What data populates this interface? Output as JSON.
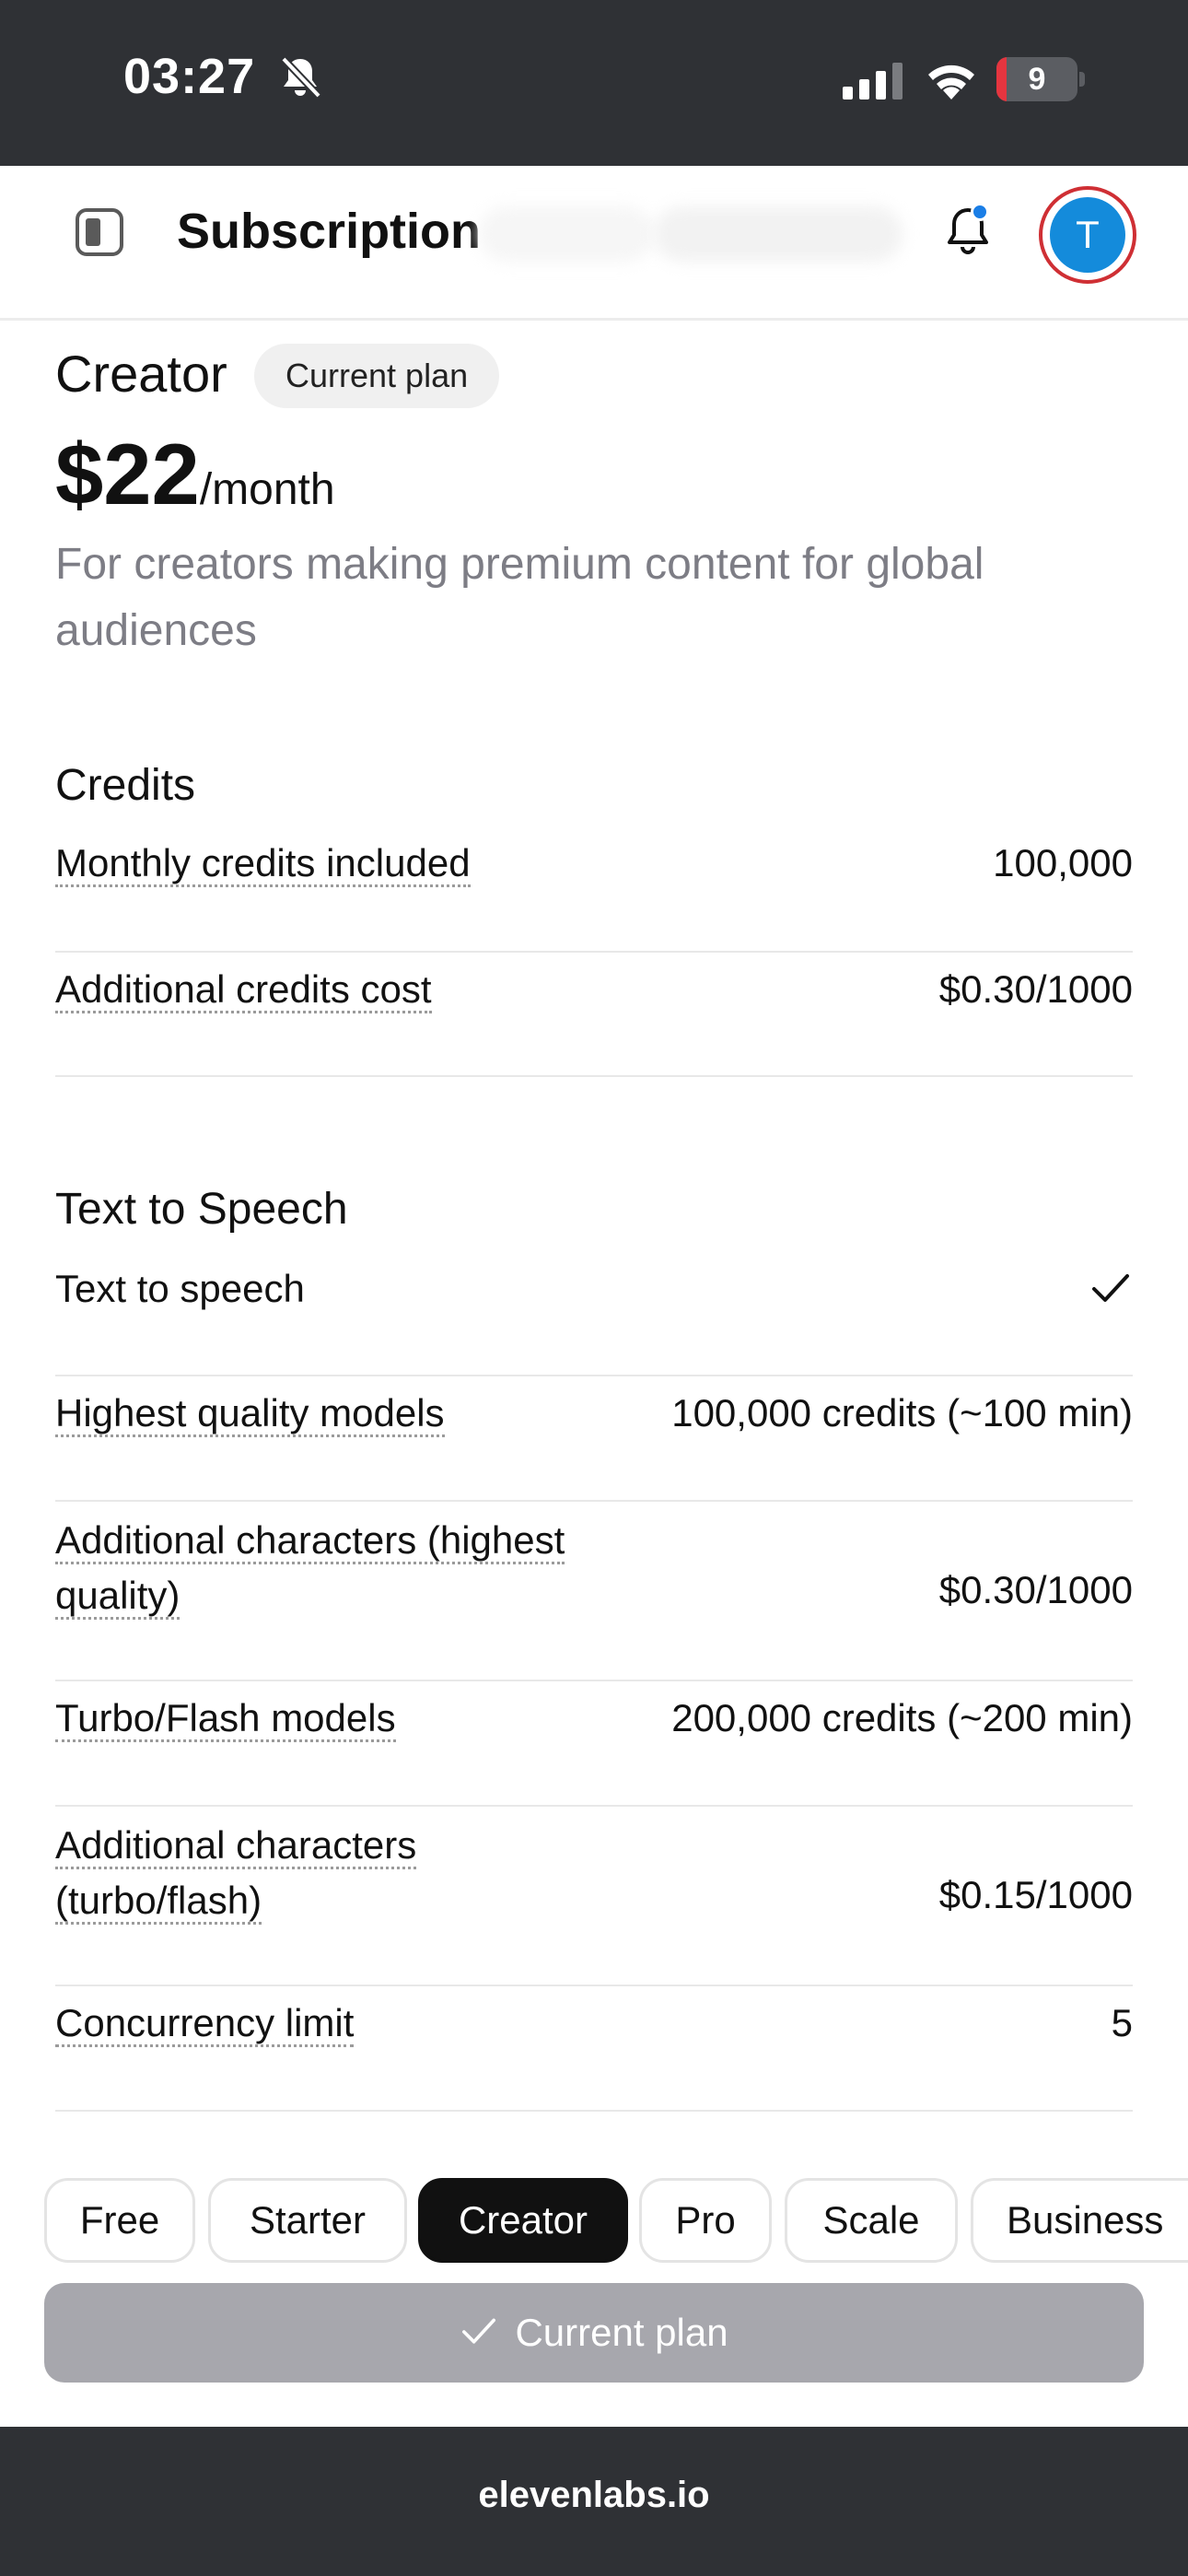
{
  "status_bar": {
    "time": "03:27",
    "battery": "9",
    "battery_level": 0.09
  },
  "header": {
    "title": "Subscription",
    "avatar_initial": "T",
    "accent_color": "#148bdb"
  },
  "plan": {
    "name": "Creator",
    "badge": "Current plan",
    "price": "$22",
    "period": "/month",
    "description": "For creators making premium content for global audiences"
  },
  "sections": {
    "credits": {
      "title": "Credits",
      "rows": [
        {
          "label": "Monthly credits included",
          "value": "100,000"
        },
        {
          "label": "Additional credits cost",
          "value": "$0.30/1000"
        }
      ]
    },
    "tts": {
      "title": "Text to Speech",
      "rows": [
        {
          "label": "Text to speech",
          "value": "check"
        },
        {
          "label": "Highest quality models",
          "value": "100,000 credits (~100 min)"
        },
        {
          "label": "Additional characters (highest quality)",
          "label_line1": "Additional characters (highest",
          "label_line2": "quality)",
          "value": "$0.30/1000"
        },
        {
          "label": "Turbo/Flash models",
          "value": "200,000 credits (~200 min)"
        },
        {
          "label": "Additional characters (turbo/flash)",
          "label_line1": "Additional characters",
          "label_line2": "(turbo/flash)",
          "value": "$0.15/1000"
        },
        {
          "label": "Concurrency limit",
          "value": "5"
        }
      ]
    }
  },
  "plan_tabs": [
    {
      "label": "Free",
      "active": false
    },
    {
      "label": "Starter",
      "active": false
    },
    {
      "label": "Creator",
      "active": true
    },
    {
      "label": "Pro",
      "active": false
    },
    {
      "label": "Scale",
      "active": false
    },
    {
      "label": "Business",
      "active": false
    }
  ],
  "cta": {
    "label": "Current plan",
    "color": "#a7a7ad"
  },
  "browser": {
    "domain": "elevenlabs.io"
  }
}
